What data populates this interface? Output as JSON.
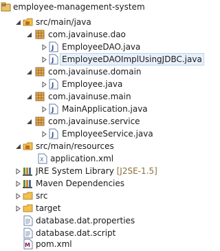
{
  "explorer": {
    "project": {
      "label": "employee-management-system",
      "icon": "maven-project-icon"
    },
    "nodes": [
      {
        "id": "src-main-java",
        "label": "src/main/java",
        "icon": "source-folder-icon"
      },
      {
        "id": "pkg-dao",
        "label": "com.javainuse.dao",
        "icon": "package-icon"
      },
      {
        "id": "file-employeedao",
        "label": "EmployeeDAO.java",
        "icon": "java-file-icon"
      },
      {
        "id": "file-employeedaoimpl",
        "label": "EmployeeDAOImplUsingJDBC.java",
        "icon": "java-file-icon",
        "selected": true
      },
      {
        "id": "pkg-domain",
        "label": "com.javainuse.domain",
        "icon": "package-icon"
      },
      {
        "id": "file-employee",
        "label": "Employee.java",
        "icon": "java-file-icon"
      },
      {
        "id": "pkg-main",
        "label": "com.javainuse.main",
        "icon": "package-icon"
      },
      {
        "id": "file-mainapplication",
        "label": "MainApplication.java",
        "icon": "java-file-icon"
      },
      {
        "id": "pkg-service",
        "label": "com.javainuse.service",
        "icon": "package-icon"
      },
      {
        "id": "file-employeeservice",
        "label": "EmployeeService.java",
        "icon": "java-file-icon"
      },
      {
        "id": "src-main-resources",
        "label": "src/main/resources",
        "icon": "source-folder-icon"
      },
      {
        "id": "file-applicationxml",
        "label": "application.xml",
        "icon": "xml-file-icon"
      },
      {
        "id": "jre-library",
        "label": "JRE System Library",
        "decoration": "[J2SE-1.5]",
        "icon": "library-icon"
      },
      {
        "id": "maven-deps",
        "label": "Maven Dependencies",
        "icon": "library-icon"
      },
      {
        "id": "folder-src",
        "label": "src",
        "icon": "folder-icon"
      },
      {
        "id": "folder-target",
        "label": "target",
        "icon": "folder-icon"
      },
      {
        "id": "file-dbproperties",
        "label": "database.dat.properties",
        "icon": "text-file-icon"
      },
      {
        "id": "file-dbscript",
        "label": "database.dat.script",
        "icon": "text-file-icon"
      },
      {
        "id": "file-pom",
        "label": "pom.xml",
        "icon": "maven-file-icon"
      }
    ]
  }
}
